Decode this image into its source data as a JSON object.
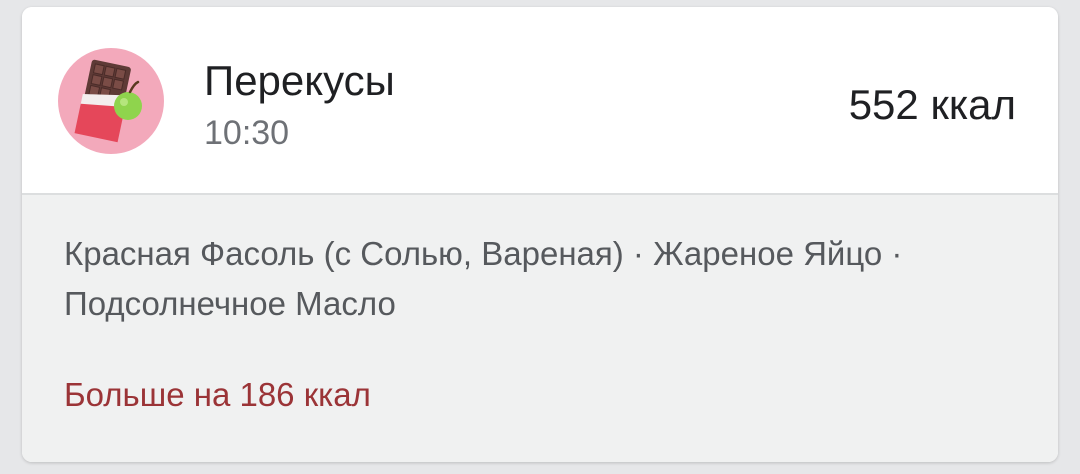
{
  "meal": {
    "title": "Перекусы",
    "time": "10:30",
    "calories": "552 ккал",
    "icon": "chocolate-apple-icon"
  },
  "foods": {
    "line1": "Красная Фасоль (с Солью, Вареная) · Жареное Яйцо ·",
    "line2": "Подсолнечное Масло"
  },
  "more": {
    "label": "Больше на 186 ккал"
  },
  "colors": {
    "avatar_bg": "#f3a9bb",
    "accent_link": "#9b3437",
    "body_bg": "#f0f1f1"
  }
}
